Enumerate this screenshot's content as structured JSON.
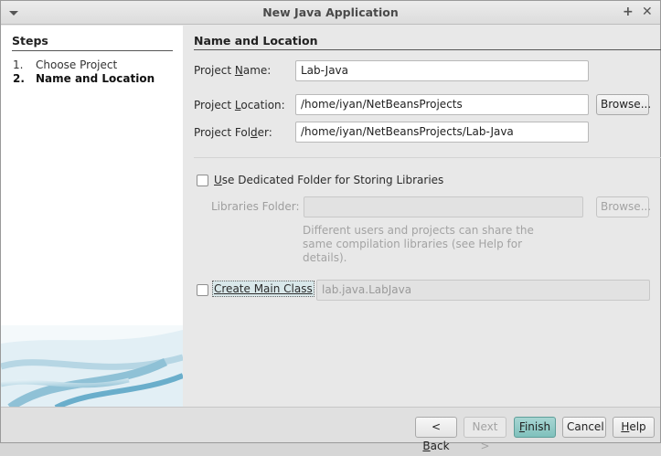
{
  "window": {
    "title": "New Java Application"
  },
  "steps": {
    "heading": "Steps",
    "items": [
      {
        "num": "1.",
        "label": "Choose Project"
      },
      {
        "num": "2.",
        "label": "Name and Location"
      }
    ]
  },
  "panel": {
    "title": "Name and Location",
    "project_name": {
      "label_pre": "Project ",
      "label_key": "N",
      "label_post": "ame:",
      "value": "Lab-Java"
    },
    "project_location": {
      "label_pre": "Project ",
      "label_key": "L",
      "label_post": "ocation:",
      "value": "/home/iyan/NetBeansProjects",
      "browse": "Browse..."
    },
    "project_folder": {
      "label_pre": "Project Fol",
      "label_key": "d",
      "label_post": "er:",
      "value": "/home/iyan/NetBeansProjects/Lab-Java"
    },
    "dedicated_folder": {
      "label_key": "U",
      "label_post": "se Dedicated Folder for Storing Libraries",
      "checked": false
    },
    "libraries_folder": {
      "label": "Libraries Folder:",
      "value": "",
      "browse": "Browse..."
    },
    "hint": "Different users and projects can share the same compilation libraries (see Help for details).",
    "main_class": {
      "label_key": "C",
      "label_post": "reate Main Class",
      "checked": false,
      "value": "lab.java.LabJava"
    }
  },
  "buttons": {
    "back": {
      "key": "B",
      "post": "ack",
      "pre": "< "
    },
    "next": "Next >",
    "finish": {
      "key": "F",
      "post": "inish"
    },
    "cancel": "Cancel",
    "help": {
      "key": "H",
      "post": "elp"
    }
  }
}
